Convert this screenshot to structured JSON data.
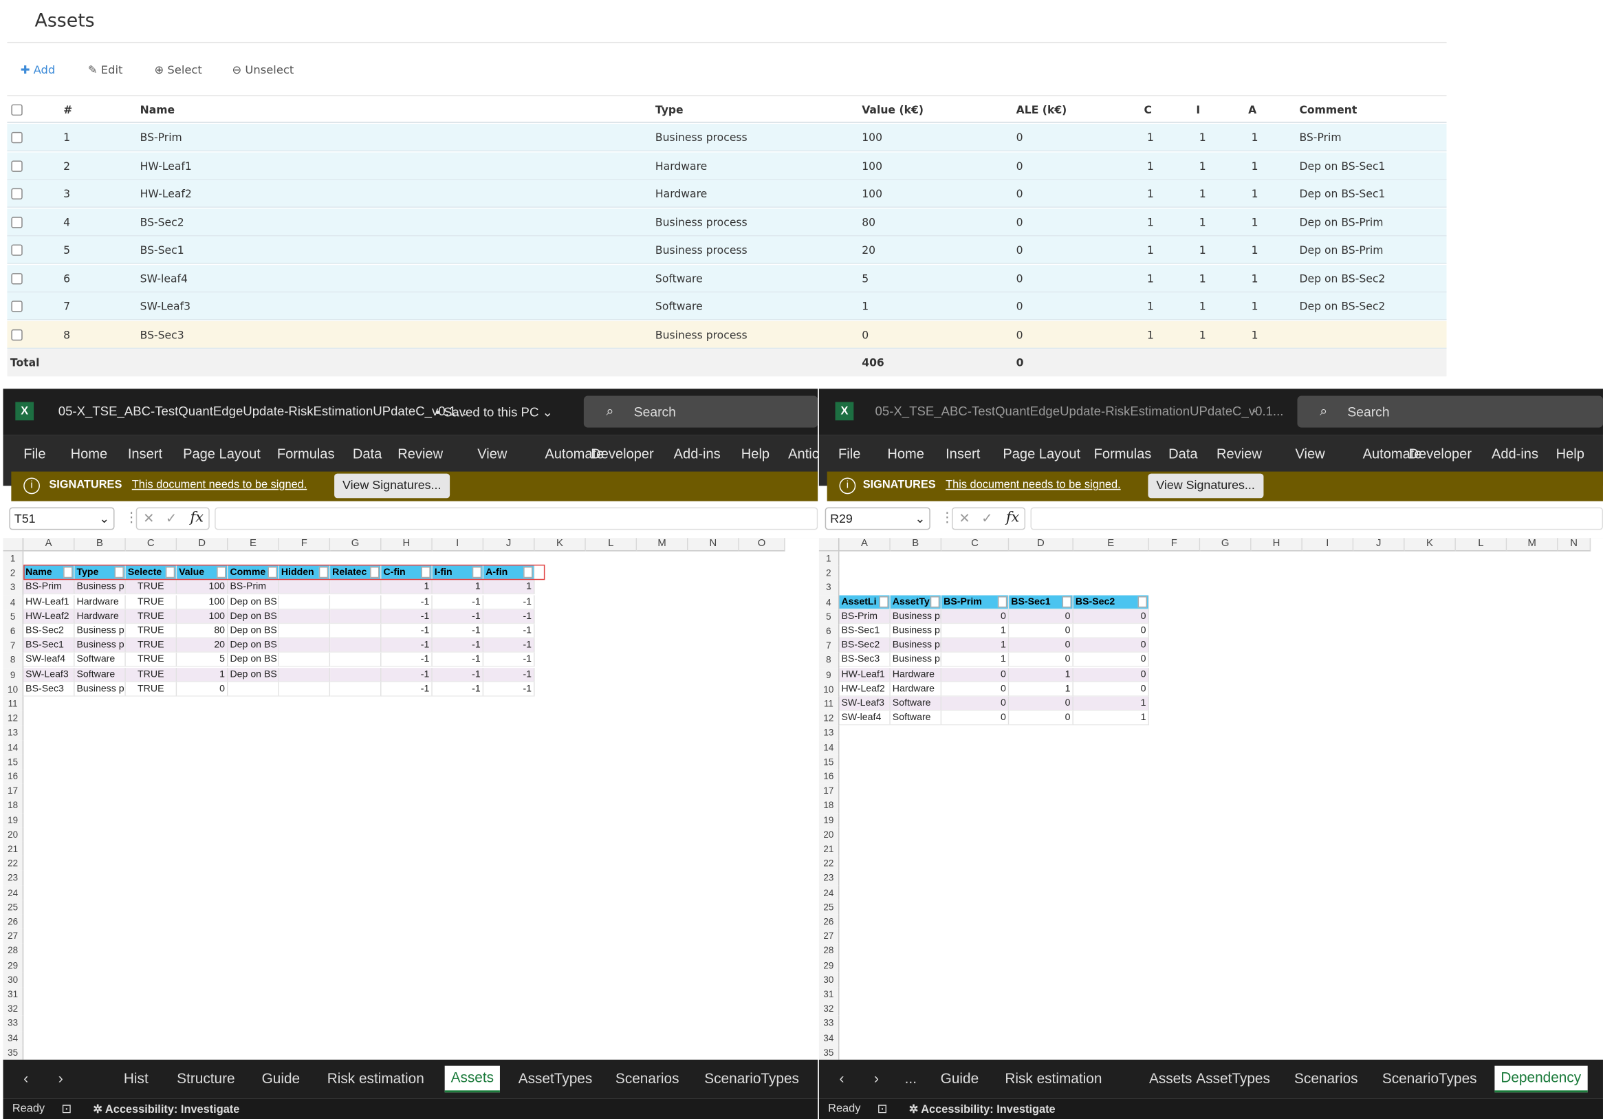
{
  "web": {
    "title": "Assets",
    "toolbar": {
      "add": "Add",
      "edit": "Edit",
      "select": "Select",
      "unselect": "Unselect"
    },
    "columns": [
      "#",
      "Name",
      "Type",
      "Value (k€)",
      "ALE (k€)",
      "C",
      "I",
      "A",
      "Comment"
    ],
    "rows": [
      {
        "n": "1",
        "name": "BS-Prim",
        "type": "Business process",
        "value": "100",
        "ale": "0",
        "c": "1",
        "i": "1",
        "a": "1",
        "comment": "BS-Prim"
      },
      {
        "n": "2",
        "name": "HW-Leaf1",
        "type": "Hardware",
        "value": "100",
        "ale": "0",
        "c": "1",
        "i": "1",
        "a": "1",
        "comment": "Dep on BS-Sec1"
      },
      {
        "n": "3",
        "name": "HW-Leaf2",
        "type": "Hardware",
        "value": "100",
        "ale": "0",
        "c": "1",
        "i": "1",
        "a": "1",
        "comment": "Dep on BS-Sec1"
      },
      {
        "n": "4",
        "name": "BS-Sec2",
        "type": "Business process",
        "value": "80",
        "ale": "0",
        "c": "1",
        "i": "1",
        "a": "1",
        "comment": "Dep on BS-Prim"
      },
      {
        "n": "5",
        "name": "BS-Sec1",
        "type": "Business process",
        "value": "20",
        "ale": "0",
        "c": "1",
        "i": "1",
        "a": "1",
        "comment": "Dep on BS-Prim"
      },
      {
        "n": "6",
        "name": "SW-leaf4",
        "type": "Software",
        "value": "5",
        "ale": "0",
        "c": "1",
        "i": "1",
        "a": "1",
        "comment": "Dep on BS-Sec2"
      },
      {
        "n": "7",
        "name": "SW-Leaf3",
        "type": "Software",
        "value": "1",
        "ale": "0",
        "c": "1",
        "i": "1",
        "a": "1",
        "comment": "Dep on BS-Sec2"
      },
      {
        "n": "8",
        "name": "BS-Sec3",
        "type": "Business process",
        "value": "0",
        "ale": "0",
        "c": "1",
        "i": "1",
        "a": "1",
        "comment": ""
      }
    ],
    "total_label": "Total",
    "total_value": "406",
    "total_ale": "0"
  },
  "excel_left": {
    "title": "05-X_TSE_ABC-TestQuantEdgeUpdate-RiskEstimationUPdateC_v0.1...",
    "saved": "• Saved to this PC",
    "search": "Search",
    "menu": [
      "File",
      "Home",
      "Insert",
      "Page Layout",
      "Formulas",
      "Data",
      "Review",
      "View",
      "Automate",
      "Developer",
      "Add-ins",
      "Help",
      "Antic"
    ],
    "sig_label": "SIGNATURES",
    "sig_text": "This document needs to be signed.",
    "sig_button": "View Signatures...",
    "namebox": "T51",
    "fx": "fx",
    "col_letters": [
      "A",
      "B",
      "C",
      "D",
      "E",
      "F",
      "G",
      "H",
      "I",
      "J",
      "K",
      "L",
      "M",
      "N",
      "O"
    ],
    "headers": [
      "Name",
      "Type",
      "Selecte",
      "Value",
      "Comme",
      "Hidden",
      "Relatec",
      "C-fin",
      "I-fin",
      "A-fin"
    ],
    "rows": [
      [
        "BS-Prim",
        "Business pr",
        "TRUE",
        "100",
        "BS-Prim",
        "",
        "",
        "1",
        "1",
        "1"
      ],
      [
        "HW-Leaf1",
        "Hardware",
        "TRUE",
        "100",
        "Dep on BS",
        "",
        "",
        "-1",
        "-1",
        "-1"
      ],
      [
        "HW-Leaf2",
        "Hardware",
        "TRUE",
        "100",
        "Dep on BS",
        "",
        "",
        "-1",
        "-1",
        "-1"
      ],
      [
        "BS-Sec2",
        "Business pr",
        "TRUE",
        "80",
        "Dep on BS",
        "",
        "",
        "-1",
        "-1",
        "-1"
      ],
      [
        "BS-Sec1",
        "Business pr",
        "TRUE",
        "20",
        "Dep on BS",
        "",
        "",
        "-1",
        "-1",
        "-1"
      ],
      [
        "SW-leaf4",
        "Software",
        "TRUE",
        "5",
        "Dep on BS",
        "",
        "",
        "-1",
        "-1",
        "-1"
      ],
      [
        "SW-Leaf3",
        "Software",
        "TRUE",
        "1",
        "Dep on BS",
        "",
        "",
        "-1",
        "-1",
        "-1"
      ],
      [
        "BS-Sec3",
        "Business pr",
        "TRUE",
        "0",
        "",
        "",
        "",
        "-1",
        "-1",
        "-1"
      ]
    ],
    "tabs": [
      "Hist",
      "Structure",
      "Guide",
      "Risk estimation",
      "Assets",
      "AssetTypes",
      "Scenarios",
      "ScenarioTypes"
    ],
    "active_tab": "Assets",
    "status": "Ready",
    "accessibility": "Accessibility: Investigate"
  },
  "excel_right": {
    "title": "05-X_TSE_ABC-TestQuantEdgeUpdate-RiskEstimationUPdateC_v0.1...",
    "search": "Search",
    "menu": [
      "File",
      "Home",
      "Insert",
      "Page Layout",
      "Formulas",
      "Data",
      "Review",
      "View",
      "Automate",
      "Developer",
      "Add-ins",
      "Help"
    ],
    "sig_label": "SIGNATURES",
    "sig_text": "This document needs to be signed.",
    "sig_button": "View Signatures...",
    "namebox": "R29",
    "fx": "fx",
    "col_letters": [
      "A",
      "B",
      "C",
      "D",
      "E",
      "F",
      "G",
      "H",
      "I",
      "J",
      "K",
      "L",
      "M",
      "N"
    ],
    "headers": [
      "AssetLi",
      "AssetTy",
      "BS-Prim",
      "BS-Sec1",
      "BS-Sec2"
    ],
    "rows": [
      [
        "BS-Prim",
        "Business pr",
        "0",
        "0",
        "0"
      ],
      [
        "BS-Sec1",
        "Business pr",
        "1",
        "0",
        "0"
      ],
      [
        "BS-Sec2",
        "Business pr",
        "1",
        "0",
        "0"
      ],
      [
        "BS-Sec3",
        "Business pr",
        "1",
        "0",
        "0"
      ],
      [
        "HW-Leaf1",
        "Hardware",
        "0",
        "1",
        "0"
      ],
      [
        "HW-Leaf2",
        "Hardware",
        "0",
        "1",
        "0"
      ],
      [
        "SW-Leaf3",
        "Software",
        "0",
        "0",
        "1"
      ],
      [
        "SW-leaf4",
        "Software",
        "0",
        "0",
        "1"
      ]
    ],
    "tabs": [
      "...",
      "Guide",
      "Risk estimation",
      "Assets",
      "AssetTypes",
      "Scenarios",
      "ScenarioTypes",
      "Dependency"
    ],
    "active_tab": "Dependency",
    "status": "Ready",
    "accessibility": "Accessibility: Investigate"
  },
  "row_numbers": [
    "1",
    "2",
    "3",
    "4",
    "5",
    "6",
    "7",
    "8",
    "9",
    "10",
    "11",
    "12",
    "13",
    "14",
    "15",
    "16",
    "17",
    "18",
    "19",
    "20",
    "21",
    "22",
    "23",
    "24",
    "25",
    "26",
    "27",
    "28",
    "29",
    "30",
    "31",
    "32",
    "33",
    "34",
    "35"
  ],
  "colors": {
    "accent": "#3d8bd8",
    "excel_green": "#1a7a3a",
    "sig_bar": "#6e5a00",
    "table_header": "#4bc4f0"
  }
}
